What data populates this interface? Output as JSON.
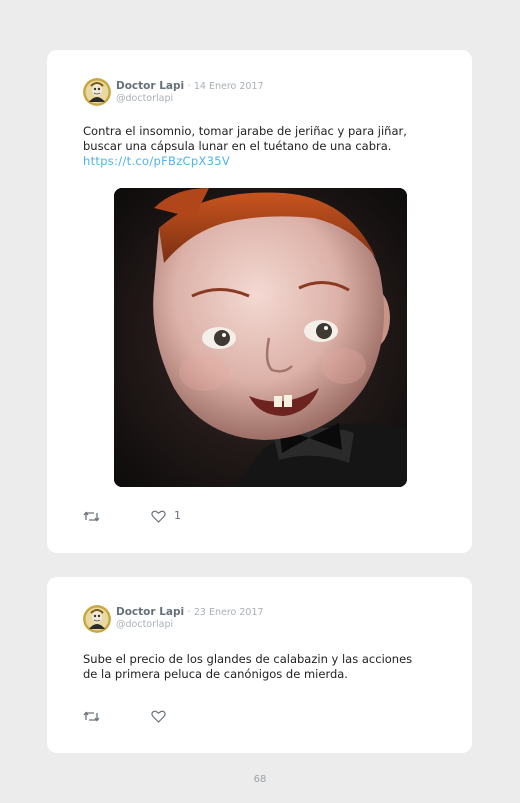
{
  "tweets": [
    {
      "author": "Doctor Lapi",
      "separator": "·",
      "date": "14 Enero 2017",
      "handle": "@doctorlapi",
      "text_lines": [
        "Contra el insomnio, tomar jarabe de jeriñac y para jiñar,",
        "buscar una cápsula lunar en el tuétano de una cabra."
      ],
      "link": "https://t.co/pFBzCpX35V",
      "like_count": "1",
      "actions": [
        "retweet-icon",
        "heart-icon"
      ]
    },
    {
      "author": "Doctor Lapi",
      "separator": "·",
      "date": "23 Enero 2017",
      "handle": "@doctorlapi",
      "text_lines": [
        "Sube el precio de los glandes de calabazin y las acciones",
        "de la primera peluca de canónigos de mierda."
      ],
      "actions": [
        "retweet-icon",
        "heart-icon"
      ]
    }
  ],
  "page_number": "68",
  "colors": {
    "background": "#ececec",
    "card": "#ffffff",
    "author": "#66707a",
    "meta": "#a9b0b6",
    "link": "#4fb3ea",
    "text": "#222222"
  }
}
